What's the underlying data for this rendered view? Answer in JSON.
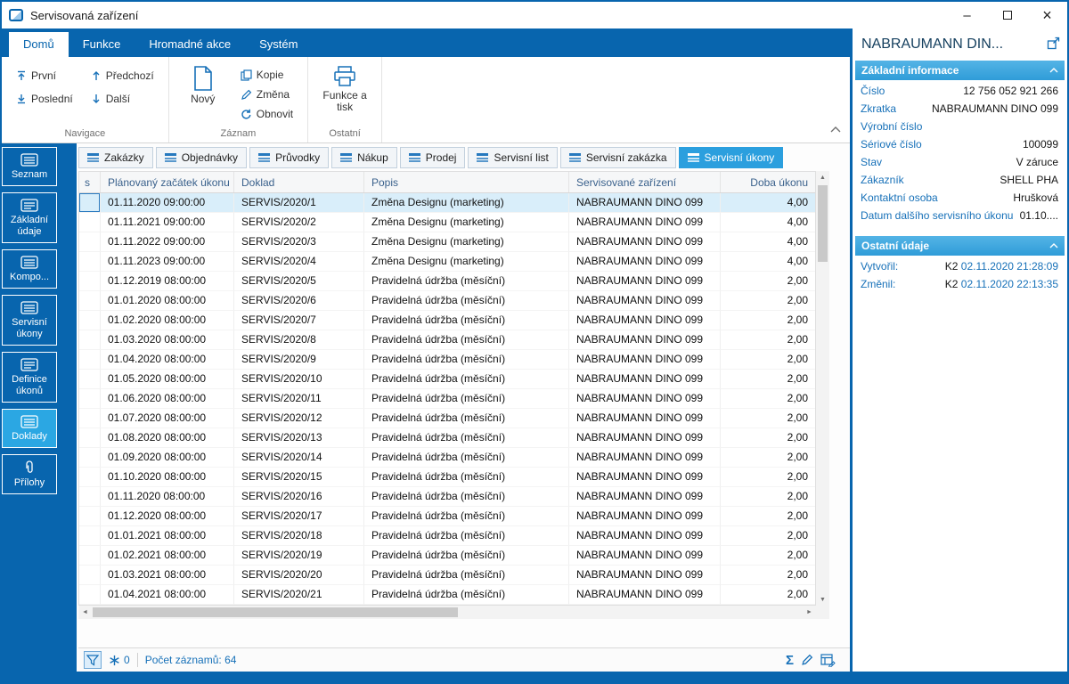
{
  "window": {
    "title": "Servisovaná zařízení"
  },
  "icons": {
    "scroll_up": "▲",
    "scroll_down": "▼",
    "scroll_left": "◄",
    "scroll_right": "►",
    "sum": "Σ",
    "minimize": "–",
    "close": "×"
  },
  "ribbon": {
    "tabs": [
      {
        "label": "Domů",
        "active": true
      },
      {
        "label": "Funkce"
      },
      {
        "label": "Hromadné akce"
      },
      {
        "label": "Systém"
      }
    ],
    "nav": {
      "group": "Navigace",
      "first": "První",
      "last": "Poslední",
      "prev": "Předchozí",
      "next": "Další"
    },
    "record": {
      "group": "Záznam",
      "new": "Nový",
      "copy": "Kopie",
      "change": "Změna",
      "refresh": "Obnovit"
    },
    "other": {
      "group": "Ostatní",
      "func_print": "Funkce a tisk"
    }
  },
  "sidebar": {
    "items": [
      {
        "label": "Seznam"
      },
      {
        "label": "Základní údaje"
      },
      {
        "label": "Kompo..."
      },
      {
        "label": "Servisní úkony"
      },
      {
        "label": "Definice úkonů"
      },
      {
        "label": "Doklady",
        "active": true
      },
      {
        "label": "Přílohy"
      }
    ]
  },
  "content": {
    "tabs": [
      {
        "label": "Zakázky"
      },
      {
        "label": "Objednávky"
      },
      {
        "label": "Průvodky"
      },
      {
        "label": "Nákup"
      },
      {
        "label": "Prodej"
      },
      {
        "label": "Servisní list"
      },
      {
        "label": "Servisní zakázka"
      },
      {
        "label": "Servisní úkony",
        "active": true
      }
    ],
    "table": {
      "columns": [
        "s",
        "Plánovaný začátek úkonu",
        "Doklad",
        "Popis",
        "Servisované zařízení",
        "Doba úkonu"
      ],
      "rows": [
        {
          "start": "01.11.2020 09:00:00",
          "doc": "SERVIS/2020/1",
          "desc": "Změna Designu (marketing)",
          "device": "NABRAUMANN DINO 099",
          "dur": "4,00",
          "selected": true
        },
        {
          "start": "01.11.2021 09:00:00",
          "doc": "SERVIS/2020/2",
          "desc": "Změna Designu (marketing)",
          "device": "NABRAUMANN DINO 099",
          "dur": "4,00"
        },
        {
          "start": "01.11.2022 09:00:00",
          "doc": "SERVIS/2020/3",
          "desc": "Změna Designu (marketing)",
          "device": "NABRAUMANN DINO 099",
          "dur": "4,00"
        },
        {
          "start": "01.11.2023 09:00:00",
          "doc": "SERVIS/2020/4",
          "desc": "Změna Designu (marketing)",
          "device": "NABRAUMANN DINO 099",
          "dur": "4,00"
        },
        {
          "start": "01.12.2019 08:00:00",
          "doc": "SERVIS/2020/5",
          "desc": "Pravidelná údržba (měsíční)",
          "device": "NABRAUMANN DINO 099",
          "dur": "2,00"
        },
        {
          "start": "01.01.2020 08:00:00",
          "doc": "SERVIS/2020/6",
          "desc": "Pravidelná údržba (měsíční)",
          "device": "NABRAUMANN DINO 099",
          "dur": "2,00"
        },
        {
          "start": "01.02.2020 08:00:00",
          "doc": "SERVIS/2020/7",
          "desc": "Pravidelná údržba (měsíční)",
          "device": "NABRAUMANN DINO 099",
          "dur": "2,00"
        },
        {
          "start": "01.03.2020 08:00:00",
          "doc": "SERVIS/2020/8",
          "desc": "Pravidelná údržba (měsíční)",
          "device": "NABRAUMANN DINO 099",
          "dur": "2,00"
        },
        {
          "start": "01.04.2020 08:00:00",
          "doc": "SERVIS/2020/9",
          "desc": "Pravidelná údržba (měsíční)",
          "device": "NABRAUMANN DINO 099",
          "dur": "2,00"
        },
        {
          "start": "01.05.2020 08:00:00",
          "doc": "SERVIS/2020/10",
          "desc": "Pravidelná údržba (měsíční)",
          "device": "NABRAUMANN DINO 099",
          "dur": "2,00"
        },
        {
          "start": "01.06.2020 08:00:00",
          "doc": "SERVIS/2020/11",
          "desc": "Pravidelná údržba (měsíční)",
          "device": "NABRAUMANN DINO 099",
          "dur": "2,00"
        },
        {
          "start": "01.07.2020 08:00:00",
          "doc": "SERVIS/2020/12",
          "desc": "Pravidelná údržba (měsíční)",
          "device": "NABRAUMANN DINO 099",
          "dur": "2,00"
        },
        {
          "start": "01.08.2020 08:00:00",
          "doc": "SERVIS/2020/13",
          "desc": "Pravidelná údržba (měsíční)",
          "device": "NABRAUMANN DINO 099",
          "dur": "2,00"
        },
        {
          "start": "01.09.2020 08:00:00",
          "doc": "SERVIS/2020/14",
          "desc": "Pravidelná údržba (měsíční)",
          "device": "NABRAUMANN DINO 099",
          "dur": "2,00"
        },
        {
          "start": "01.10.2020 08:00:00",
          "doc": "SERVIS/2020/15",
          "desc": "Pravidelná údržba (měsíční)",
          "device": "NABRAUMANN DINO 099",
          "dur": "2,00"
        },
        {
          "start": "01.11.2020 08:00:00",
          "doc": "SERVIS/2020/16",
          "desc": "Pravidelná údržba (měsíční)",
          "device": "NABRAUMANN DINO 099",
          "dur": "2,00"
        },
        {
          "start": "01.12.2020 08:00:00",
          "doc": "SERVIS/2020/17",
          "desc": "Pravidelná údržba (měsíční)",
          "device": "NABRAUMANN DINO 099",
          "dur": "2,00"
        },
        {
          "start": "01.01.2021 08:00:00",
          "doc": "SERVIS/2020/18",
          "desc": "Pravidelná údržba (měsíční)",
          "device": "NABRAUMANN DINO 099",
          "dur": "2,00"
        },
        {
          "start": "01.02.2021 08:00:00",
          "doc": "SERVIS/2020/19",
          "desc": "Pravidelná údržba (měsíční)",
          "device": "NABRAUMANN DINO 099",
          "dur": "2,00"
        },
        {
          "start": "01.03.2021 08:00:00",
          "doc": "SERVIS/2020/20",
          "desc": "Pravidelná údržba (měsíční)",
          "device": "NABRAUMANN DINO 099",
          "dur": "2,00"
        },
        {
          "start": "01.04.2021 08:00:00",
          "doc": "SERVIS/2020/21",
          "desc": "Pravidelná údržba (měsíční)",
          "device": "NABRAUMANN DINO 099",
          "dur": "2,00"
        }
      ]
    },
    "status": {
      "count": "0",
      "records": "Počet záznamů: 64"
    }
  },
  "detail_panel": {
    "title": "NABRAUMANN DIN...",
    "sections": [
      {
        "title": "Základní informace",
        "fields": [
          {
            "label": "Číslo",
            "value": "12 756 052 921 266"
          },
          {
            "label": "Zkratka",
            "value": "NABRAUMANN DINO 099"
          },
          {
            "label": "Výrobní číslo",
            "value": ""
          },
          {
            "label": "Sériové číslo",
            "value": "100099"
          },
          {
            "label": "Stav",
            "value": "V záruce"
          },
          {
            "label": "Zákazník",
            "value": "SHELL PHA"
          },
          {
            "label": "Kontaktní osoba",
            "value": "Hrušková"
          },
          {
            "label": "Datum dalšího servisního úkonu",
            "value": "01.10...."
          }
        ]
      },
      {
        "title": "Ostatní údaje",
        "fields": [
          {
            "label": "Vytvořil:",
            "user": "K2",
            "value": "02.11.2020 21:28:09"
          },
          {
            "label": "Změnil:",
            "user": "K2",
            "value": "02.11.2020 22:13:35"
          }
        ]
      }
    ]
  }
}
